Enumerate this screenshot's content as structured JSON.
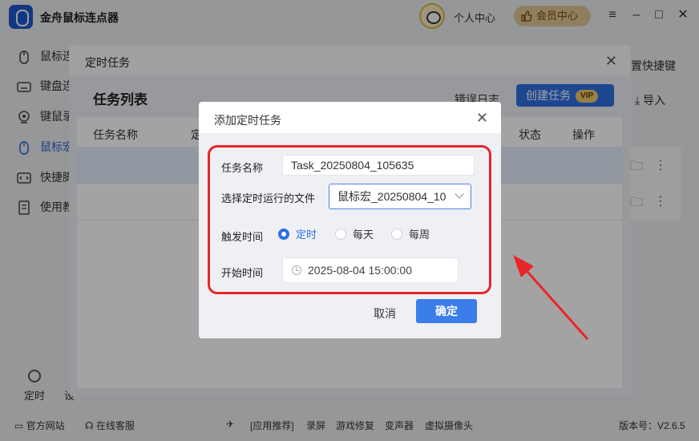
{
  "app": {
    "title": "金舟鼠标连点器",
    "personal_center": "个人中心",
    "vip_center": "会员中心",
    "version": "版本号：V2.6.5"
  },
  "sidebar": {
    "items": [
      {
        "label": "鼠标连",
        "icon": "mouse-click-icon"
      },
      {
        "label": "键盘连",
        "icon": "keyboard-icon"
      },
      {
        "label": "键鼠录",
        "icon": "record-icon"
      },
      {
        "label": "鼠标宏",
        "icon": "mouse-icon",
        "active": true
      },
      {
        "label": "快捷脚",
        "icon": "code-icon"
      },
      {
        "label": "使用教",
        "icon": "book-icon"
      }
    ],
    "bottom_label": "定时",
    "bottom_label_2": "设"
  },
  "right_panel": {
    "shortcut_setting": "置快捷键",
    "import": "导入"
  },
  "footer": {
    "official_site": "官方网站",
    "online_service": "在线客服",
    "recommend": "[应用推荐]",
    "links": [
      "录屏",
      "游戏修复",
      "变声器",
      "虚拟摄像头"
    ]
  },
  "task_dialog": {
    "title": "定时任务",
    "list_title": "任务列表",
    "error_log": "错误日志",
    "create_button": "创建任务",
    "vip_badge": "VIP",
    "columns": [
      "任务名称",
      "定",
      "状态",
      "操作"
    ]
  },
  "add_dialog": {
    "title": "添加定时任务",
    "name_label": "任务名称",
    "name_value": "Task_20250804_105635",
    "file_label": "选择定时运行的文件",
    "file_value": "鼠标宏_20250804_10",
    "trigger_label": "触发时间",
    "trigger_options": [
      "定时",
      "每天",
      "每周"
    ],
    "trigger_selected": "定时",
    "start_label": "开始时间",
    "start_value": "2025-08-04 15:00:00",
    "cancel_button": "取消",
    "ok_button": "确定"
  },
  "colors": {
    "accent": "#2f6fe4",
    "annotation": "#e8262a"
  }
}
